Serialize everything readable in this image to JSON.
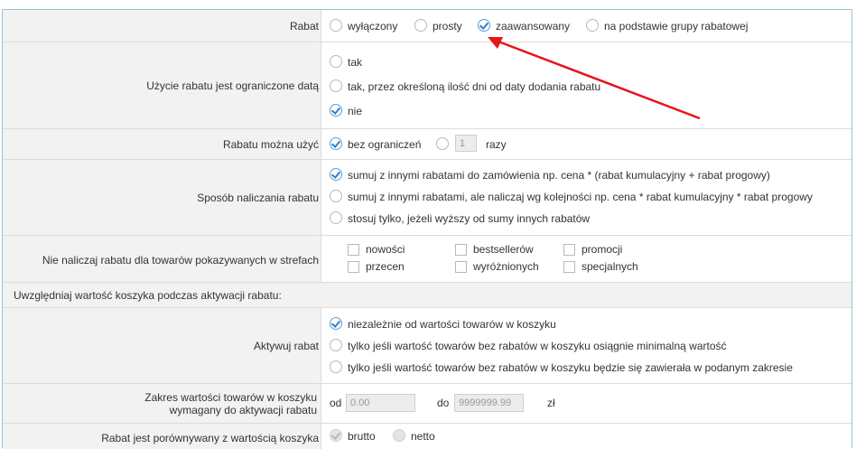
{
  "rows": {
    "rabat": {
      "label": "Rabat",
      "options": [
        "wyłączony",
        "prosty",
        "zaawansowany",
        "na podstawie grupy rabatowej"
      ],
      "selected": "zaawansowany"
    },
    "data_limit": {
      "label": "Użycie rabatu jest ograniczone datą",
      "options": [
        "tak",
        "tak, przez określoną ilość dni od daty dodania rabatu",
        "nie"
      ],
      "selected": "nie"
    },
    "usage": {
      "label": "Rabatu można użyć",
      "option_unlimited": "bez ograniczeń",
      "count_value": "1",
      "count_unit": "razy",
      "selected": "bez ograniczeń"
    },
    "calc_method": {
      "label": "Sposób naliczania rabatu",
      "options": [
        "sumuj z innymi rabatami do zamówienia np. cena * (rabat kumulacyjny + rabat progowy)",
        "sumuj z innymi rabatami, ale naliczaj wg kolejności np. cena * rabat kumulacyjny * rabat progowy",
        "stosuj tylko, jeżeli wyższy od sumy innych rabatów"
      ],
      "selected_index": 0
    },
    "zones": {
      "label": "Nie naliczaj rabatu dla towarów pokazywanych w strefach",
      "options": [
        "nowości",
        "bestsellerów",
        "promocji",
        "przecen",
        "wyróżnionych",
        "specjalnych"
      ]
    },
    "section": {
      "title": "Uwzględniaj wartość koszyka podczas aktywacji rabatu:"
    },
    "activate": {
      "label": "Aktywuj rabat",
      "options": [
        "niezależnie od wartości towarów w koszyku",
        "tylko jeśli wartość towarów bez rabatów w koszyku osiągnie minimalną wartość",
        "tylko jeśli wartość towarów bez rabatów w koszyku będzie się zawierała w podanym zakresie"
      ],
      "selected_index": 0
    },
    "range": {
      "label": "Zakres wartości towarów w koszyku wymagany do aktywacji rabatu",
      "from_label": "od",
      "from_value": "0.00",
      "to_label": "do",
      "to_value": "9999999.99",
      "currency": "zł"
    },
    "compare": {
      "label": "Rabat jest porównywany z wartością koszyka",
      "options": [
        "brutto",
        "netto"
      ],
      "selected": "brutto"
    }
  },
  "colors": {
    "check": "#2f7fc7",
    "arrow": "#e8141c",
    "gray_row": "#f2f2f2"
  }
}
